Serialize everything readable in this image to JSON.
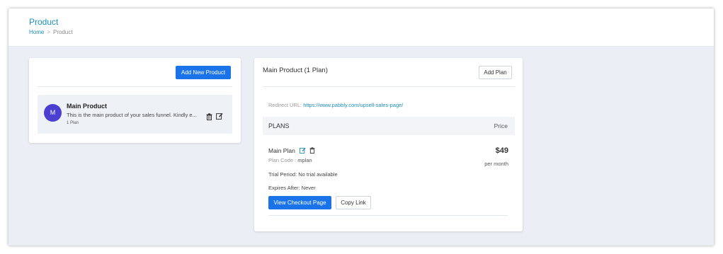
{
  "header": {
    "title": "Product",
    "breadcrumb": {
      "home": "Home",
      "separator": ">",
      "current": "Product"
    }
  },
  "left_card": {
    "add_button": "Add New Product",
    "product": {
      "avatar_letter": "M",
      "name": "Main Product",
      "description": "This is the main product of your sales funnel. Kindly e...",
      "plans": "1 Plan",
      "icons": [
        "trash-icon",
        "edit-icon"
      ]
    }
  },
  "right_card": {
    "title": "Main Product (1 Plan)",
    "add_plan_button": "Add Plan",
    "redirect_label": "Redirect URL:",
    "redirect_url": "https://www.pabbly.com/upsell-sales-page/",
    "plans_header": {
      "left": "PLANS",
      "right": "Price"
    },
    "plan": {
      "name": "Main Plan",
      "code_label": "Plan Code :",
      "code": "mplan",
      "trial": "Trial Period: No trial available",
      "expires": "Expires After: Never",
      "price": "$49",
      "period": "per month",
      "view_checkout": "View Checkout Page",
      "copy_link": "Copy Link",
      "icons": [
        "edit-icon",
        "trash-icon"
      ]
    }
  },
  "colors": {
    "accent": "#1c8fb8",
    "primary_button": "#1a73e8",
    "avatar": "#4a3fd1",
    "background": "#ebeff5"
  }
}
